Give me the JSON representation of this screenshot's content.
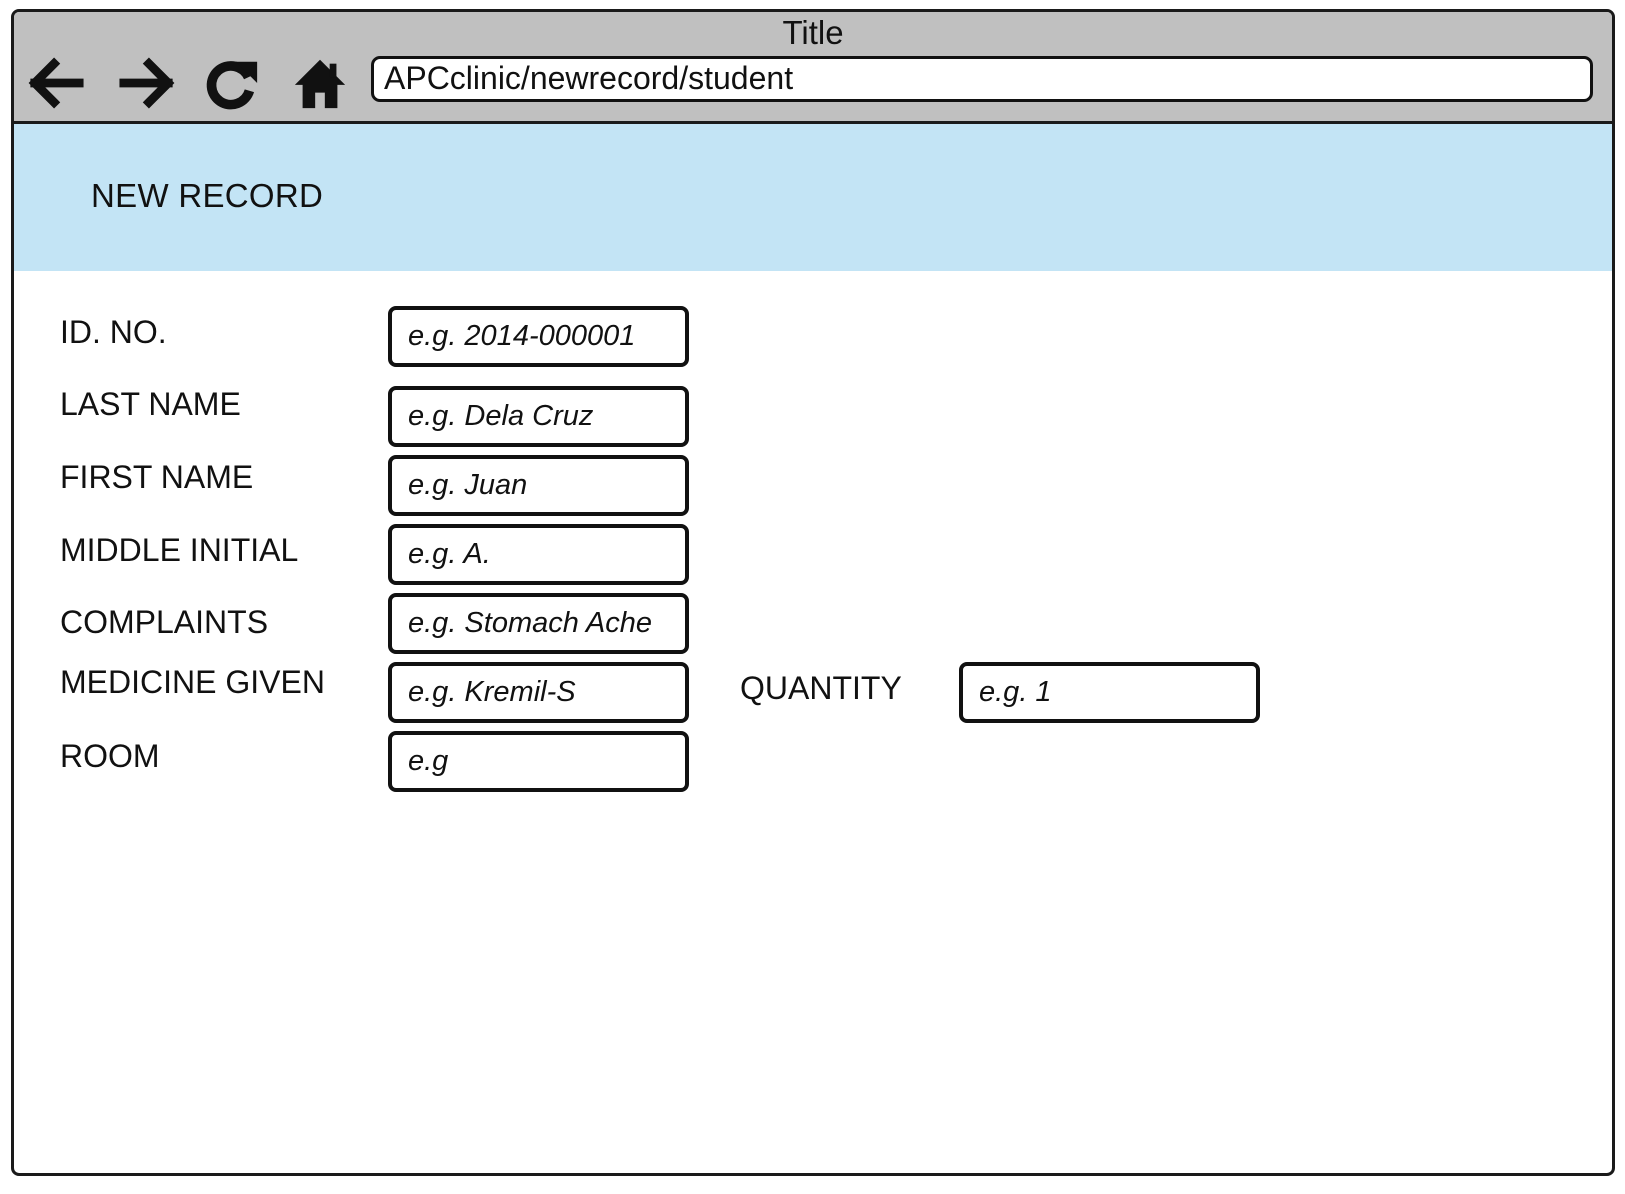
{
  "window": {
    "title": "Title"
  },
  "browser": {
    "address": "APCclinic/newrecord/student",
    "nav": {
      "back_icon": "arrow-left-icon",
      "forward_icon": "arrow-right-icon",
      "reload_icon": "reload-icon",
      "home_icon": "home-icon"
    }
  },
  "header": {
    "title": "NEW RECORD",
    "background": "#c3e4f5"
  },
  "form": {
    "id_no": {
      "label": "ID. NO.",
      "placeholder": "e.g. 2014-000001"
    },
    "last_name": {
      "label": "LAST NAME",
      "placeholder": "e.g. Dela Cruz"
    },
    "first_name": {
      "label": "FIRST NAME",
      "placeholder": "e.g. Juan"
    },
    "middle_initial": {
      "label": "MIDDLE INITIAL",
      "placeholder": "e.g. A."
    },
    "complaints": {
      "label": "COMPLAINTS",
      "placeholder": "e.g. Stomach Ache"
    },
    "medicine_given": {
      "label": "MEDICINE GIVEN",
      "placeholder": "e.g. Kremil-S"
    },
    "quantity": {
      "label": "QUANTITY",
      "placeholder": "e.g. 1"
    },
    "room": {
      "label": "ROOM",
      "placeholder": "e.g"
    }
  }
}
